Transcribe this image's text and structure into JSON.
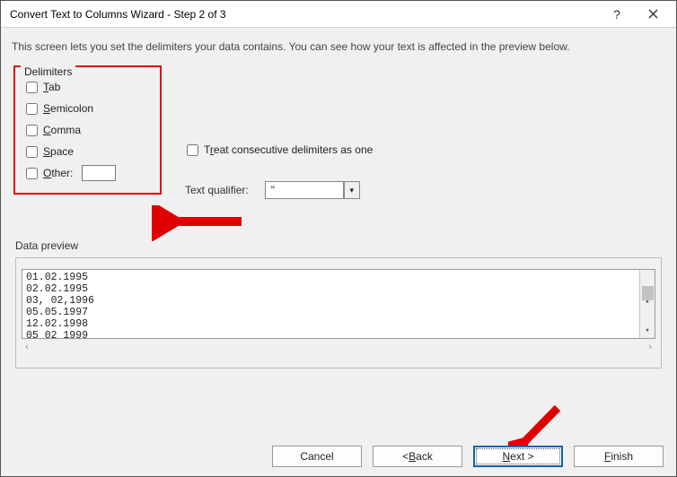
{
  "title": "Convert Text to Columns Wizard - Step 2 of 3",
  "instruction": "This screen lets you set the delimiters your data contains.  You can see how your text is affected in the preview below.",
  "delimiters": {
    "legend": "Delimiters",
    "tab": {
      "label_pre": "T",
      "label_rest": "ab",
      "checked": false
    },
    "semicolon": {
      "label_pre": "S",
      "label_rest": "emicolon",
      "checked": false
    },
    "comma": {
      "label_pre": "C",
      "label_rest": "omma",
      "checked": false
    },
    "space": {
      "label_pre": "S",
      "label_rest": "pace",
      "checked": false
    },
    "other": {
      "label_pre": "O",
      "label_rest": "ther:",
      "checked": false,
      "value": ""
    }
  },
  "treat_consecutive": {
    "label_pre": "T",
    "label_mid": "r",
    "label_rest": "eat consecutive delimiters as one",
    "checked": false
  },
  "qualifier": {
    "label_pre": "Text ",
    "label_ul": "q",
    "label_rest": "ualifier:",
    "value": "\""
  },
  "preview": {
    "label_pre": "Data ",
    "label_ul": "p",
    "label_rest": "review",
    "lines": [
      "01.02.1995",
      "02.02.1995",
      "03, 02,1996",
      "05.05.1997",
      "12.02.1998",
      "05 02 1999"
    ]
  },
  "buttons": {
    "cancel": "Cancel",
    "back": "< Back",
    "next": "Next >",
    "finish": "Finish"
  },
  "annotations": {
    "arrow1": "red-left-arrow",
    "arrow2": "red-down-arrow"
  }
}
